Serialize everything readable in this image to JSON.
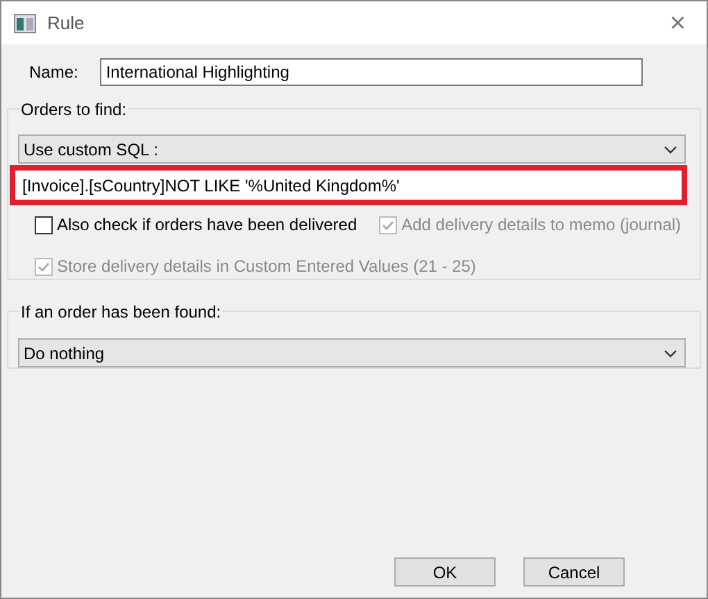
{
  "window": {
    "title": "Rule",
    "close": "×"
  },
  "name_field": {
    "label": "Name:",
    "value": "International Highlighting"
  },
  "orders_group": {
    "title": "Orders to find:",
    "dropdown": "Use custom SQL :",
    "sql": {
      "value": "[Invoice].[sCountry]NOT LIKE '%United Kingdom%'",
      "highlighted": true
    },
    "options": [
      {
        "label": "Also check if orders have been delivered",
        "checked": false,
        "disabled": false
      },
      {
        "label": "Add delivery details to memo (journal)",
        "checked": true,
        "disabled": true
      },
      {
        "label": "Store delivery details in Custom Entered Values (21 - 25)",
        "checked": true,
        "disabled": true
      }
    ]
  },
  "action_group": {
    "title": "If an order has been found:",
    "dropdown": "Do nothing"
  },
  "buttons": [
    "OK",
    "Cancel"
  ]
}
